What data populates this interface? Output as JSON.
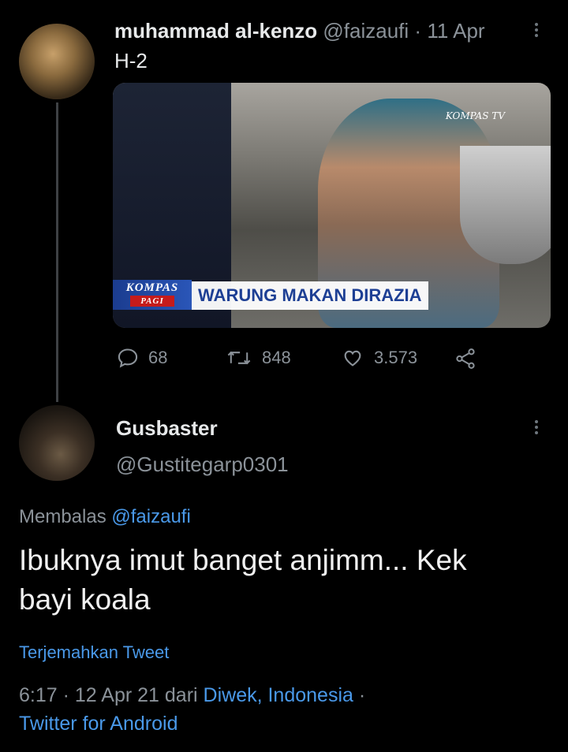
{
  "tweet": {
    "author_name": "muhammad al-kenzo",
    "handle": "@faizaufi",
    "separator": "·",
    "date": "11 Apr",
    "text": "H-2",
    "media": {
      "logo": "KOMPAS TV",
      "program_top": "KOMPAS",
      "program_bottom": "PAGI",
      "headline": "WARUNG MAKAN DIRAZIA"
    },
    "actions": {
      "reply_count": "68",
      "retweet_count": "848",
      "like_count": "3.573"
    }
  },
  "reply": {
    "author_name": "Gusbaster",
    "handle": "@Gustitegarp0301",
    "replying_prefix": "Membalas",
    "replying_to": "@faizaufi",
    "text_line1": "Ibuknya imut banget anjimm... Kek",
    "text_line2": "bayi koala",
    "translate": "Terjemahkan Tweet",
    "time": "6:17",
    "sep1": "·",
    "date": "12 Apr 21",
    "from_prefix": "dari",
    "location": "Diwek, Indonesia",
    "sep2": "·",
    "client": "Twitter for Android"
  },
  "icons": [
    "reply-icon",
    "retweet-icon",
    "like-icon",
    "share-icon",
    "more-options-icon"
  ]
}
